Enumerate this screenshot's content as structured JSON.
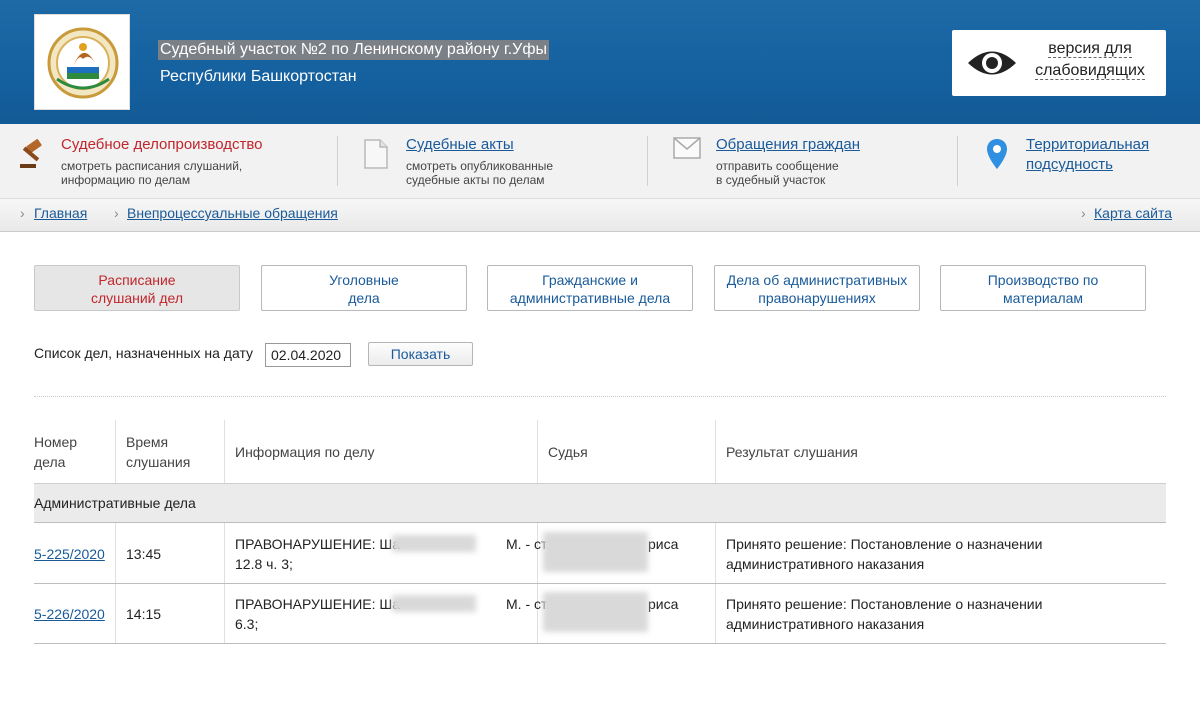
{
  "header": {
    "court_name": "Судебный участок №2 по Ленинскому району г.Уфы",
    "region": "Республики Башкортостан",
    "vision_line1": "версия для",
    "vision_line2": "слабовидящих"
  },
  "services": [
    {
      "title": "Судебное делопроизводство",
      "desc1": "смотреть расписания слушаний,",
      "desc2": "информацию по делам",
      "icon": "gavel-icon"
    },
    {
      "title": "Судебные акты",
      "desc1": "смотреть опубликованные",
      "desc2": "судебные акты по делам",
      "icon": "document-icon"
    },
    {
      "title": "Обращения граждан",
      "desc1": "отправить сообщение",
      "desc2": "в судебный участок",
      "icon": "envelope-icon"
    },
    {
      "title1": "Территориальная",
      "title2": "подсудность",
      "icon": "map-pin-icon"
    }
  ],
  "breadcrumbs": {
    "home": "Главная",
    "current": "Внепроцессуальные обращения",
    "sitemap": "Карта сайта"
  },
  "tabs": [
    {
      "line1": "Расписание",
      "line2": "слушаний дел"
    },
    {
      "line1": "Уголовные",
      "line2": "дела"
    },
    {
      "line1": "Гражданские и",
      "line2": "административные дела"
    },
    {
      "line1": "Дела об административных",
      "line2": "правонарушениях"
    },
    {
      "line1": "Производство по",
      "line2": "материалам"
    }
  ],
  "filter": {
    "label": "Список дел, назначенных на дату",
    "date": "02.04.2020",
    "button": "Показать"
  },
  "table": {
    "headers": {
      "number1": "Номер",
      "number2": "дела",
      "time1": "Время",
      "time2": "слушания",
      "info": "Информация по делу",
      "judge": "Судья",
      "result": "Результат слушания"
    },
    "group": "Административные дела",
    "rows": [
      {
        "number": "5-225/2020",
        "time": "13:45",
        "info_prefix": "ПРАВОНАРУШЕНИЕ: Ша",
        "info_suffix": "М. - ст.",
        "info_line2": "12.8 ч. 3;",
        "judge_suffix": "риса",
        "result1": "Принято решение: Постановление о назначении",
        "result2": "административного наказания"
      },
      {
        "number": "5-226/2020",
        "time": "14:15",
        "info_prefix": "ПРАВОНАРУШЕНИЕ: Ша",
        "info_suffix": "М. - ст.",
        "info_line2": "6.3;",
        "judge_suffix": "риса",
        "result1": "Принято решение: Постановление о назначении",
        "result2": "административного наказания"
      }
    ]
  },
  "colors": {
    "header_blue": "#1561a0",
    "link": "#1a5a99",
    "active_red": "#c0262c"
  }
}
